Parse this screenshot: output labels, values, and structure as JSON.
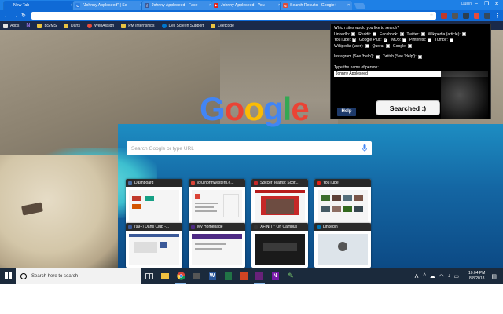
{
  "browser": {
    "tabs": [
      {
        "title": "New Tab",
        "favicon_color": "#0f6ad6",
        "active": true
      },
      {
        "title": "\"Johnny Appleseed\" | Se",
        "favicon_color": "#2a7de1",
        "active": false
      },
      {
        "title": "Johnny Appleseed - Face",
        "favicon_color": "#3b5998",
        "active": false
      },
      {
        "title": "Johnny Appleseed - You",
        "favicon_color": "#e62117",
        "active": false
      },
      {
        "title": "Search Results - Google+",
        "favicon_color": "#dd4b39",
        "active": false
      }
    ],
    "profile_name": "Quinn",
    "address_value": ""
  },
  "bookmarks": [
    {
      "label": "Apps",
      "color": "#e0e0e0"
    },
    {
      "label": "",
      "color": "#5b3b8c"
    },
    {
      "label": "BS/MS",
      "color": "#e8c342"
    },
    {
      "label": "Darts",
      "color": "#e74c3c"
    },
    {
      "label": "WebAssign",
      "color": "#7fb3e0"
    },
    {
      "label": "PM Internships",
      "color": "#2a9fd6"
    },
    {
      "label": "Dell Screen Support",
      "color": "#0076ce"
    },
    {
      "label": "Leetcode",
      "color": "#f39c12"
    }
  ],
  "google": {
    "logo_letters": [
      "G",
      "o",
      "o",
      "g",
      "l",
      "e"
    ],
    "logo_colors": [
      "#4285F4",
      "#EA4335",
      "#FBBC05",
      "#4285F4",
      "#34A853",
      "#EA4335"
    ],
    "search_placeholder": "Search Google or type URL"
  },
  "tiles": [
    {
      "title": "Dashboard",
      "icon_color": "#4a6fa5"
    },
    {
      "title": "@u.northwestern.e...",
      "icon_color": "#db4437"
    },
    {
      "title": "Soccer Teams: Scor...",
      "icon_color": "#c62828"
    },
    {
      "title": "YouTube",
      "icon_color": "#e62117"
    },
    {
      "title": "(99+) Darts Club -...",
      "icon_color": "#3b5998"
    },
    {
      "title": "My Homepage",
      "icon_color": "#4e2a84"
    },
    {
      "title": "XFINITY On Campus",
      "icon_color": "#333333"
    },
    {
      "title": "Linkedin",
      "icon_color": "#0077b5"
    }
  ],
  "extension": {
    "question": "Which sites would you like to search?",
    "row1": [
      {
        "label": "LinkedIn:",
        "checked": false
      },
      {
        "label": "Reddit:",
        "checked": false
      },
      {
        "label": "Facebook:",
        "checked": true
      },
      {
        "label": "Twitter:",
        "checked": false
      },
      {
        "label": "Wikipedia (article):",
        "checked": false
      }
    ],
    "row2": [
      {
        "label": "YouTube:",
        "checked": true
      },
      {
        "label": "Google Plus:",
        "checked": true
      },
      {
        "label": "IMDb:",
        "checked": false
      },
      {
        "label": "Pinterest:",
        "checked": false
      },
      {
        "label": "Tumblr:",
        "checked": false
      }
    ],
    "row3": [
      {
        "label": "Wikipedia (user):",
        "checked": false
      },
      {
        "label": "Quora:",
        "checked": false
      },
      {
        "label": "Google:",
        "checked": false
      }
    ],
    "row4": [
      {
        "label": "Instagram (See 'Help'):",
        "checked": false
      },
      {
        "label": "Twitch (See 'Help'):",
        "checked": false
      }
    ],
    "name_prompt": "Type the name of person:",
    "name_value": "Johnny Appleseed",
    "help_label": "Help",
    "searched_label": "Searched :)"
  },
  "taskbar": {
    "search_placeholder": "Search here to search",
    "time": "10:04 PM",
    "date": "8/8/2018"
  }
}
